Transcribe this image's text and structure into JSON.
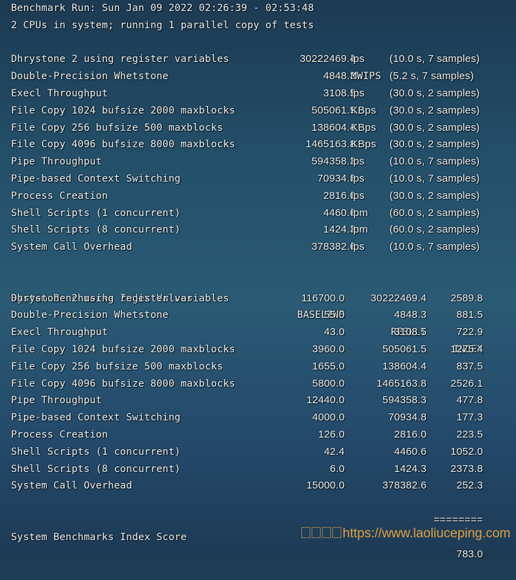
{
  "header": {
    "run_line": "Benchmark Run: Sun Jan 09 2022 02:26:39 - 02:53:48",
    "cpu_line": "2 CPUs in system; running 1 parallel copy of tests"
  },
  "raw_results": [
    {
      "name": "Dhrystone 2 using register variables",
      "value": "30222469.4",
      "unit": "lps",
      "samples": "(10.0 s, 7 samples)"
    },
    {
      "name": "Double-Precision Whetstone",
      "value": "4848.3",
      "unit": "MWIPS",
      "samples": "(5.2 s, 7 samples)"
    },
    {
      "name": "Execl Throughput",
      "value": "3108.5",
      "unit": "lps",
      "samples": "(30.0 s, 2 samples)"
    },
    {
      "name": "File Copy 1024 bufsize 2000 maxblocks",
      "value": "505061.5",
      "unit": "KBps",
      "samples": "(30.0 s, 2 samples)"
    },
    {
      "name": "File Copy 256 bufsize 500 maxblocks",
      "value": "138604.4",
      "unit": "KBps",
      "samples": "(30.0 s, 2 samples)"
    },
    {
      "name": "File Copy 4096 bufsize 8000 maxblocks",
      "value": "1465163.8",
      "unit": "KBps",
      "samples": "(30.0 s, 2 samples)"
    },
    {
      "name": "Pipe Throughput",
      "value": "594358.3",
      "unit": "lps",
      "samples": "(10.0 s, 7 samples)"
    },
    {
      "name": "Pipe-based Context Switching",
      "value": "70934.8",
      "unit": "lps",
      "samples": "(10.0 s, 7 samples)"
    },
    {
      "name": "Process Creation",
      "value": "2816.0",
      "unit": "lps",
      "samples": "(30.0 s, 2 samples)"
    },
    {
      "name": "Shell Scripts (1 concurrent)",
      "value": "4460.6",
      "unit": "lpm",
      "samples": "(60.0 s, 2 samples)"
    },
    {
      "name": "Shell Scripts (8 concurrent)",
      "value": "1424.3",
      "unit": "lpm",
      "samples": "(60.0 s, 2 samples)"
    },
    {
      "name": "System Call Overhead",
      "value": "378382.6",
      "unit": "lps",
      "samples": "(10.0 s, 7 samples)"
    }
  ],
  "index_table": {
    "title": "System Benchmarks Index Values",
    "headers": {
      "baseline": "BASELINE",
      "result": "RESULT",
      "index": "INDEX"
    },
    "rows": [
      {
        "name": "Dhrystone 2 using register variables",
        "baseline": "116700.0",
        "result": "30222469.4",
        "index": "2589.8"
      },
      {
        "name": "Double-Precision Whetstone",
        "baseline": "55.0",
        "result": "4848.3",
        "index": "881.5"
      },
      {
        "name": "Execl Throughput",
        "baseline": "43.0",
        "result": "3108.5",
        "index": "722.9"
      },
      {
        "name": "File Copy 1024 bufsize 2000 maxblocks",
        "baseline": "3960.0",
        "result": "505061.5",
        "index": "1275.4"
      },
      {
        "name": "File Copy 256 bufsize 500 maxblocks",
        "baseline": "1655.0",
        "result": "138604.4",
        "index": "837.5"
      },
      {
        "name": "File Copy 4096 bufsize 8000 maxblocks",
        "baseline": "5800.0",
        "result": "1465163.8",
        "index": "2526.1"
      },
      {
        "name": "Pipe Throughput",
        "baseline": "12440.0",
        "result": "594358.3",
        "index": "477.8"
      },
      {
        "name": "Pipe-based Context Switching",
        "baseline": "4000.0",
        "result": "70934.8",
        "index": "177.3"
      },
      {
        "name": "Process Creation",
        "baseline": "126.0",
        "result": "2816.0",
        "index": "223.5"
      },
      {
        "name": "Shell Scripts (1 concurrent)",
        "baseline": "42.4",
        "result": "4460.6",
        "index": "1052.0"
      },
      {
        "name": "Shell Scripts (8 concurrent)",
        "baseline": "6.0",
        "result": "1424.3",
        "index": "2373.8"
      },
      {
        "name": "System Call Overhead",
        "baseline": "15000.0",
        "result": "378382.6",
        "index": "252.3"
      }
    ],
    "separator": "========",
    "score_label": "System Benchmarks Index Score",
    "score_value": "783.0"
  },
  "watermark": {
    "url": "https://www.laoliuceping.com",
    "color": "#e0a040"
  }
}
